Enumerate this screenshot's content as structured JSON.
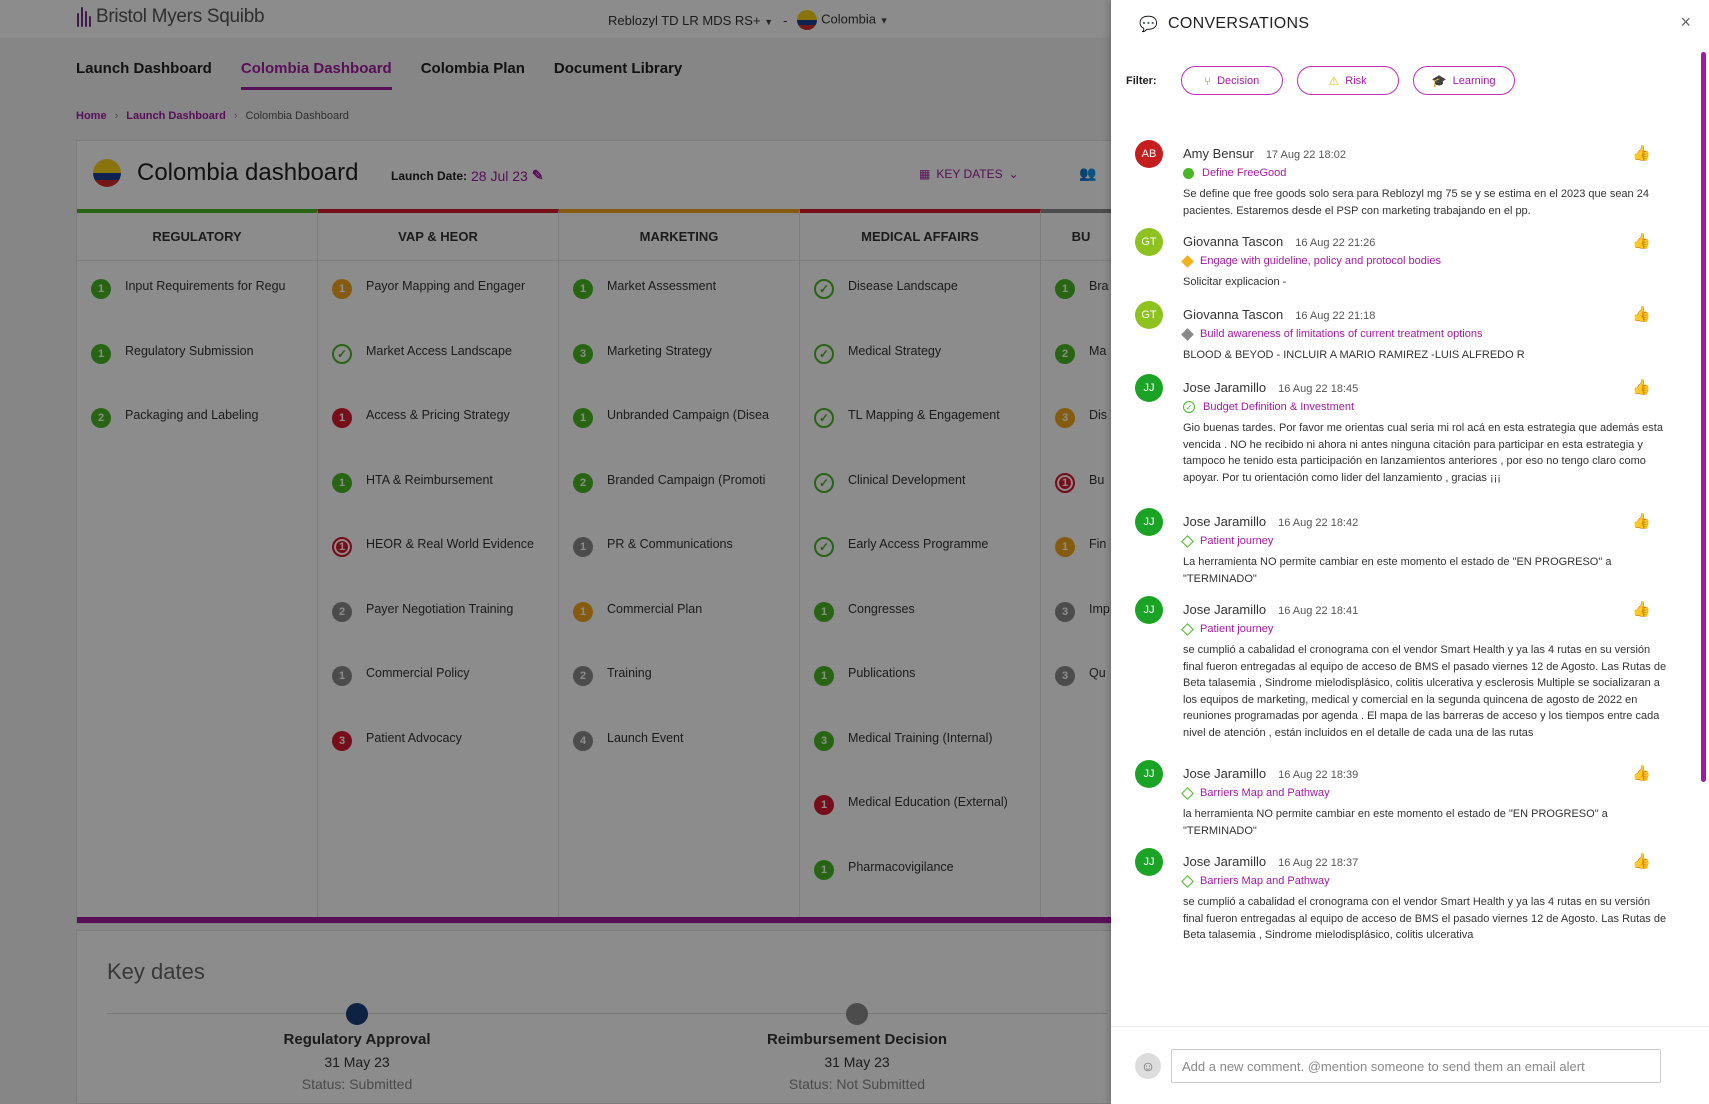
{
  "header": {
    "brand": "Bristol Myers Squibb",
    "product": "Reblozyl TD LR MDS RS+",
    "separator": "-",
    "country": "Colombia"
  },
  "nav": [
    "Launch Dashboard",
    "Colombia Dashboard",
    "Colombia Plan",
    "Document Library"
  ],
  "breadcrumb": {
    "home": "Home",
    "parent": "Launch Dashboard",
    "current": "Colombia Dashboard"
  },
  "dashboard": {
    "title": "Colombia dashboard",
    "launch_label": "Launch Date:",
    "launch_value": "28 Jul 23",
    "key_dates_btn": "KEY DATES",
    "columns": [
      {
        "title": "REGULATORY",
        "color": "#47b824",
        "items": [
          {
            "badge": "1",
            "status": "green",
            "label": "Input Requirements for Regu"
          },
          {
            "badge": "1",
            "status": "green",
            "label": "Regulatory Submission"
          },
          {
            "badge": "2",
            "status": "green",
            "label": "Packaging and Labeling"
          }
        ]
      },
      {
        "title": "VAP & HEOR",
        "color": "#d9182f",
        "items": [
          {
            "badge": "1",
            "status": "yellow",
            "label": "Payor Mapping and Engager"
          },
          {
            "badge": "✓",
            "status": "check",
            "label": "Market Access Landscape"
          },
          {
            "badge": "1",
            "status": "red",
            "label": "Access & Pricing Strategy"
          },
          {
            "badge": "1",
            "status": "green",
            "label": "HTA & Reimbursement"
          },
          {
            "badge": "1",
            "status": "red-ring",
            "label": "HEOR & Real World Evidence"
          },
          {
            "badge": "2",
            "status": "grey",
            "label": "Payer Negotiation Training"
          },
          {
            "badge": "1",
            "status": "grey",
            "label": "Commercial Policy"
          },
          {
            "badge": "3",
            "status": "red",
            "label": "Patient Advocacy"
          }
        ]
      },
      {
        "title": "MARKETING",
        "color": "#f2a81d",
        "items": [
          {
            "badge": "1",
            "status": "green",
            "label": "Market Assessment"
          },
          {
            "badge": "3",
            "status": "green",
            "label": "Marketing Strategy"
          },
          {
            "badge": "1",
            "status": "green",
            "label": "Unbranded Campaign (Disea"
          },
          {
            "badge": "2",
            "status": "green",
            "label": "Branded Campaign (Promoti"
          },
          {
            "badge": "1",
            "status": "grey",
            "label": "PR & Communications"
          },
          {
            "badge": "1",
            "status": "yellow",
            "label": "Commercial Plan"
          },
          {
            "badge": "2",
            "status": "grey",
            "label": "Training"
          },
          {
            "badge": "4",
            "status": "grey",
            "label": "Launch Event"
          }
        ]
      },
      {
        "title": "MEDICAL AFFAIRS",
        "color": "#d9182f",
        "items": [
          {
            "badge": "✓",
            "status": "check",
            "label": "Disease Landscape"
          },
          {
            "badge": "✓",
            "status": "check",
            "label": "Medical Strategy"
          },
          {
            "badge": "✓",
            "status": "check",
            "label": "TL Mapping & Engagement"
          },
          {
            "badge": "✓",
            "status": "check",
            "label": "Clinical Development"
          },
          {
            "badge": "✓",
            "status": "check",
            "label": "Early Access Programme"
          },
          {
            "badge": "1",
            "status": "green",
            "label": "Congresses"
          },
          {
            "badge": "1",
            "status": "green",
            "label": "Publications"
          },
          {
            "badge": "3",
            "status": "green",
            "label": "Medical Training (Internal)"
          },
          {
            "badge": "1",
            "status": "red",
            "label": "Medical Education (External)"
          },
          {
            "badge": "1",
            "status": "green",
            "label": "Pharmacovigilance"
          }
        ]
      },
      {
        "title": "BU",
        "color": "#8a8a8a",
        "items": [
          {
            "badge": "1",
            "status": "green",
            "label": "Bra"
          },
          {
            "badge": "2",
            "status": "green",
            "label": "Ma"
          },
          {
            "badge": "3",
            "status": "yellow",
            "label": "Dis"
          },
          {
            "badge": "1",
            "status": "red-ring",
            "label": "Bu"
          },
          {
            "badge": "1",
            "status": "yellow",
            "label": "Fin"
          },
          {
            "badge": "3",
            "status": "grey",
            "label": "Imp"
          },
          {
            "badge": "3",
            "status": "grey",
            "label": "Qu"
          }
        ]
      }
    ]
  },
  "key_dates": {
    "title": "Key dates",
    "events": [
      {
        "name": "Regulatory Approval",
        "date": "31 May 23",
        "status": "Status: Submitted",
        "color": "#1a3e7a"
      },
      {
        "name": "Reimbursement Decision",
        "date": "31 May 23",
        "status": "Status: Not Submitted",
        "color": "#8a8a8a"
      }
    ]
  },
  "panel": {
    "title": "CONVERSATIONS",
    "close": "×",
    "filter_label": "Filter:",
    "filters": [
      {
        "label": "Decision",
        "icon": "branch-icon",
        "glyph": "⑂"
      },
      {
        "label": "Risk",
        "icon": "warning-icon",
        "glyph": "⚠"
      },
      {
        "label": "Learning",
        "icon": "graduation-cap-icon",
        "glyph": "🎓"
      }
    ],
    "messages": [
      {
        "initials": "AB",
        "avatar_color": "#c41e1e",
        "author": "Amy Bensur",
        "time": "17 Aug 22 18:02",
        "topic_shape": "dot",
        "topic_color": "#47b824",
        "topic": "Define FreeGood",
        "body": "Se define que free goods solo sera para Reblozyl mg 75 se y se estima en el 2023 que sean 24 pacientes. Estaremos desde el PSP con marketing trabajando en el pp."
      },
      {
        "initials": "GT",
        "avatar_color": "#8ec21f",
        "author": "Giovanna Tascon",
        "time": "16 Aug 22 21:26",
        "topic_shape": "diamond",
        "topic_color": "#f2b21d",
        "topic": "Engage with guideline, policy and protocol bodies",
        "body": "Solicitar explicacion -"
      },
      {
        "initials": "GT",
        "avatar_color": "#8ec21f",
        "author": "Giovanna Tascon",
        "time": "16 Aug 22 21:18",
        "topic_shape": "diamond",
        "topic_color": "#8a8a8a",
        "topic": "Build awareness of limitations of current treatment options",
        "body": "BLOOD & BEYOD - INCLUIR A MARIO RAMIREZ -LUIS ALFREDO R"
      },
      {
        "initials": "JJ",
        "avatar_color": "#1aa324",
        "author": "Jose Jaramillo",
        "time": "16 Aug 22 18:45",
        "topic_shape": "check",
        "topic_color": "#47b824",
        "topic": "Budget Definition & Investment",
        "body": "Gio buenas tardes. Por favor me orientas cual seria mi rol acá en esta estrategia que además esta vencida . NO he recibido ni ahora ni antes ninguna citación para participar en esta estrategia y tampoco he tenido esta participación en lanzamientos anteriores , por eso no tengo claro como apoyar. Por tu orientación como lider del lanzamiento , gracias ¡¡¡"
      },
      {
        "initials": "JJ",
        "avatar_color": "#1aa324",
        "author": "Jose Jaramillo",
        "time": "16 Aug 22 18:42",
        "topic_shape": "diamond-outline",
        "topic_color": "#47b824",
        "topic": "Patient journey",
        "body": "La herramienta NO permite cambiar en este momento el estado de \"EN PROGRESO\" a \"TERMINADO\""
      },
      {
        "initials": "JJ",
        "avatar_color": "#1aa324",
        "author": "Jose Jaramillo",
        "time": "16 Aug 22 18:41",
        "topic_shape": "diamond-outline",
        "topic_color": "#47b824",
        "topic": "Patient journey",
        "body": "se cumplió a cabalidad el cronograma con el vendor Smart Health y ya las 4 rutas en su versión final fueron entregadas al equipo de acceso de BMS el pasado viernes 12 de Agosto. Las Rutas de Beta talasemia , Sindrome mielodisplásico, colitis ulcerativa y esclerosis Multiple se socializaran a los equipos de marketing, medical y comercial en la segunda quincena de agosto de 2022 en reuniones programadas por agenda . El mapa de las barreras de acceso y los tiempos entre cada nivel de atención , están incluidos en el detalle de cada una de las rutas"
      },
      {
        "initials": "JJ",
        "avatar_color": "#1aa324",
        "author": "Jose Jaramillo",
        "time": "16 Aug 22 18:39",
        "topic_shape": "diamond-outline",
        "topic_color": "#47b824",
        "topic": "Barriers Map and Pathway",
        "body": "la herramienta NO permite cambiar en este momento el estado de \"EN PROGRESO\" a \"TERMINADO\""
      },
      {
        "initials": "JJ",
        "avatar_color": "#1aa324",
        "author": "Jose Jaramillo",
        "time": "16 Aug 22 18:37",
        "topic_shape": "diamond-outline",
        "topic_color": "#47b824",
        "topic": "Barriers Map and Pathway",
        "body": "se cumplió a cabalidad el cronograma con el vendor Smart Health y ya las 4 rutas en su versión final fueron entregadas al equipo de acceso de BMS el pasado viernes 12 de Agosto. Las Rutas de Beta talasemia , Sindrome mielodisplásico, colitis ulcerativa"
      }
    ],
    "comment_placeholder": "Add a new comment. @mention someone to send them an email alert"
  }
}
